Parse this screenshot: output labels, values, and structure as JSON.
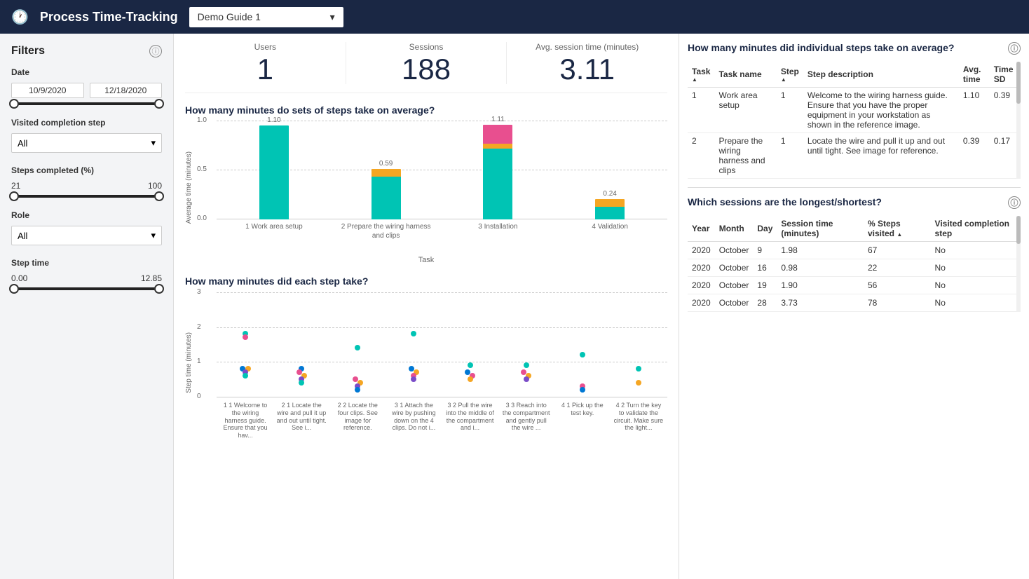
{
  "header": {
    "title": "Process Time-Tracking",
    "dropdown_value": "Demo Guide 1"
  },
  "filters": {
    "title": "Filters",
    "date": {
      "label": "Date",
      "start": "10/9/2020",
      "end": "12/18/2020",
      "start_pct": 0,
      "end_pct": 100
    },
    "completion_step": {
      "label": "Visited completion step",
      "value": "All"
    },
    "steps_completed": {
      "label": "Steps completed (%)",
      "min_val": "21",
      "max_val": "100",
      "min_pct": 0,
      "max_pct": 100
    },
    "role": {
      "label": "Role",
      "value": "All"
    },
    "step_time": {
      "label": "Step time",
      "min_val": "0.00",
      "max_val": "12.85",
      "min_pct": 0,
      "max_pct": 100
    }
  },
  "kpis": {
    "users": {
      "label": "Users",
      "value": "1"
    },
    "sessions": {
      "label": "Sessions",
      "value": "188"
    },
    "avg_session": {
      "label": "Avg. session time (minutes)",
      "value": "3.11"
    }
  },
  "bar_chart": {
    "title": "How many minutes do sets of steps take on average?",
    "y_label": "Average time (minutes)",
    "x_label": "Task",
    "bars": [
      {
        "name": "1 Work area setup",
        "value": 1.1,
        "teal_pct": 100,
        "pink_pct": 0,
        "orange_pct": 0
      },
      {
        "name": "2 Prepare the wiring harness and clips",
        "value": 0.59,
        "teal_pct": 80,
        "pink_pct": 0,
        "orange_pct": 20
      },
      {
        "name": "3 Installation",
        "value": 1.11,
        "teal_pct": 75,
        "pink_pct": 20,
        "orange_pct": 5
      },
      {
        "name": "4 Validation",
        "value": 0.24,
        "teal_pct": 60,
        "pink_pct": 0,
        "orange_pct": 40
      }
    ],
    "grid": [
      0,
      0.5,
      1.0
    ]
  },
  "scatter_chart": {
    "title": "How many minutes did each step take?",
    "y_label": "Step time (minutes)",
    "x_label": "",
    "y_max": 3,
    "steps": [
      {
        "name": "1 1 Welcome to the wiring harness guide. Ensure that you hav...",
        "short": "1 1 Welcome to the\nwiring harness guide.\nEnsure that you hav..."
      },
      {
        "name": "2 1 Locate the wire and pull it up and out until tight. See i...",
        "short": "2 1 Locate the wire\nand pull it up and\nout until tight. See i..."
      },
      {
        "name": "2 2 Locate the four clips. See image for reference.",
        "short": "2 2 Locate the four\nclips. See image for\nreference."
      },
      {
        "name": "3 1 Attach the wire by pushing down on the 4 clips. Do not i...",
        "short": "3 1 Attach the wire\nby pushing down on\nthe 4 clips. Do not i..."
      },
      {
        "name": "3 2 Pull the wire into the middle of the compartment and i...",
        "short": "3 2 Pull the wire into\nthe middle of the\ncompartment and i..."
      },
      {
        "name": "3 3 Reach into the compartment and gently pull the wire ...",
        "short": "3 3 Reach into the\ncompartment and\ngently pull the wire ..."
      },
      {
        "name": "4 1 Pick up the test key.",
        "short": "4 1 Pick up the test\nkey."
      },
      {
        "name": "4 2 Turn the key to validate the circuit. Make sure the light...",
        "short": "4 2 Turn the key to\nvalidate the circuit.\nMake sure the light..."
      }
    ]
  },
  "avg_steps_table": {
    "title": "How many minutes did individual steps take on average?",
    "columns": [
      "Task",
      "Task name",
      "Step",
      "Step description",
      "Avg. time",
      "Time SD"
    ],
    "rows": [
      {
        "task": "1",
        "task_name": "Work area setup",
        "step": "1",
        "step_desc": "Welcome to the wiring harness guide. Ensure that you have the proper equipment in your workstation as shown in the reference image.",
        "avg_time": "1.10",
        "time_sd": "0.39"
      },
      {
        "task": "2",
        "task_name": "Prepare the wiring harness and clips",
        "step": "1",
        "step_desc": "Locate the wire and pull it up and out until tight. See image for reference.",
        "avg_time": "0.39",
        "time_sd": "0.17"
      }
    ]
  },
  "sessions_table": {
    "title": "Which sessions are the longest/shortest?",
    "columns": [
      "Year",
      "Month",
      "Day",
      "Session time (minutes)",
      "% Steps visited",
      "Visited completion step"
    ],
    "rows": [
      {
        "year": "2020",
        "month": "October",
        "day": "9",
        "session_time": "1.98",
        "steps_visited": "67",
        "completion": "No"
      },
      {
        "year": "2020",
        "month": "October",
        "day": "16",
        "session_time": "0.98",
        "steps_visited": "22",
        "completion": "No"
      },
      {
        "year": "2020",
        "month": "October",
        "day": "19",
        "session_time": "1.90",
        "steps_visited": "56",
        "completion": "No"
      },
      {
        "year": "2020",
        "month": "October",
        "day": "28",
        "session_time": "3.73",
        "steps_visited": "78",
        "completion": "No"
      }
    ]
  },
  "colors": {
    "teal": "#00c4b4",
    "pink": "#e84f8f",
    "orange": "#f5a623",
    "navy": "#1a2744",
    "accent": "#1a2744"
  }
}
